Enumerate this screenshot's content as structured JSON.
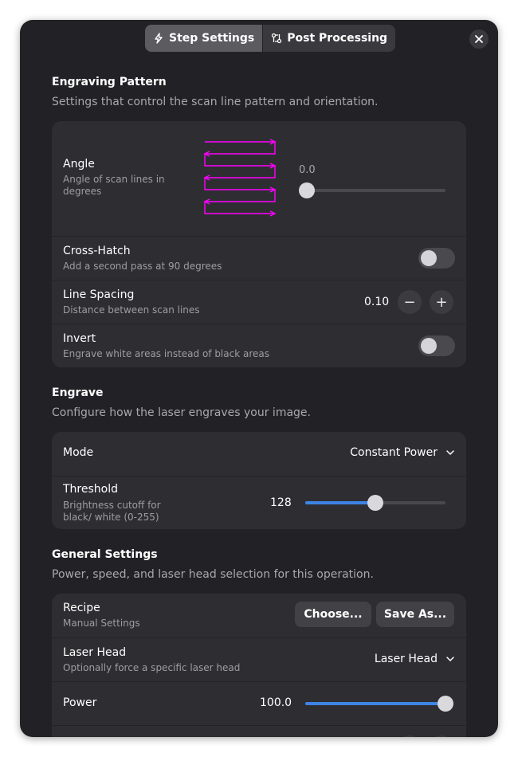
{
  "tabs": [
    {
      "label": "Step Settings",
      "icon": "lightning-icon",
      "active": true
    },
    {
      "label": "Post Processing",
      "icon": "post-process-icon",
      "active": false
    }
  ],
  "close_icon": "close-icon",
  "engraving_pattern": {
    "title": "Engraving Pattern",
    "description": "Settings that control the scan line pattern and orientation.",
    "angle": {
      "title": "Angle",
      "subtitle": "Angle of scan lines in degrees",
      "value": "0.0",
      "preview_color": "#ff00ff"
    },
    "cross_hatch": {
      "title": "Cross-Hatch",
      "subtitle": "Add a second pass at 90 degrees",
      "enabled": false
    },
    "line_spacing": {
      "title": "Line Spacing",
      "subtitle": "Distance between scan lines",
      "value": "0.10",
      "minus": "−",
      "plus": "+"
    },
    "invert": {
      "title": "Invert",
      "subtitle": "Engrave white areas instead of black areas",
      "enabled": false
    }
  },
  "engrave": {
    "title": "Engrave",
    "description": "Configure how the laser engraves your image.",
    "mode": {
      "title": "Mode",
      "value": "Constant Power"
    },
    "threshold": {
      "title": "Threshold",
      "subtitle": "Brightness cutoff for black/ white (0-255)",
      "value": "128",
      "level": 128,
      "max": 255
    }
  },
  "general": {
    "title": "General Settings",
    "description": "Power, speed, and laser head selection for this operation.",
    "recipe": {
      "title": "Recipe",
      "subtitle": "Manual Settings",
      "choose_label": "Choose...",
      "save_label": "Save As..."
    },
    "laser_head": {
      "title": "Laser Head",
      "subtitle": "Optionally force a specific laser head",
      "value": "Laser Head"
    },
    "power": {
      "title": "Power",
      "value": "100.0",
      "level": 100,
      "max": 100
    }
  },
  "colors": {
    "accent": "#3d84e5",
    "preview": "#ff00ff",
    "background": "#222226",
    "card": "#2e2e32"
  }
}
